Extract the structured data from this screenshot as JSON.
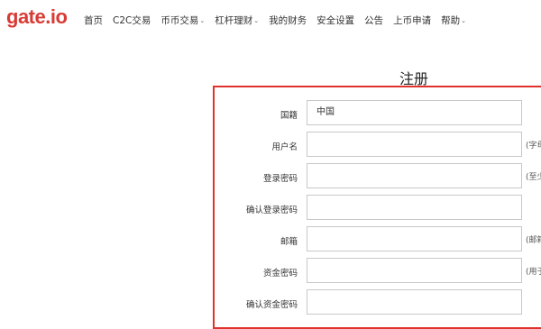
{
  "header": {
    "logo": "gate.io",
    "nav": [
      {
        "label": "首页",
        "dropdown": false
      },
      {
        "label": "C2C交易",
        "dropdown": false
      },
      {
        "label": "币币交易",
        "dropdown": true
      },
      {
        "label": "杠杆理财",
        "dropdown": true
      },
      {
        "label": "我的财务",
        "dropdown": false
      },
      {
        "label": "安全设置",
        "dropdown": false
      },
      {
        "label": "公告",
        "dropdown": false
      },
      {
        "label": "上币申请",
        "dropdown": false
      },
      {
        "label": "帮助",
        "dropdown": true
      }
    ]
  },
  "register": {
    "title": "注册",
    "fields": [
      {
        "label": "国籍",
        "value": "中国",
        "hint": ""
      },
      {
        "label": "用户名",
        "value": "",
        "hint": "(字母"
      },
      {
        "label": "登录密码",
        "value": "",
        "hint": "(至少"
      },
      {
        "label": "确认登录密码",
        "value": "",
        "hint": ""
      },
      {
        "label": "邮箱",
        "value": "",
        "hint": "(邮箱"
      },
      {
        "label": "资金密码",
        "value": "",
        "hint": "(用于"
      },
      {
        "label": "确认资金密码",
        "value": "",
        "hint": ""
      }
    ]
  },
  "colors": {
    "brand": "#d83b36",
    "form_border": "#e0322d"
  }
}
